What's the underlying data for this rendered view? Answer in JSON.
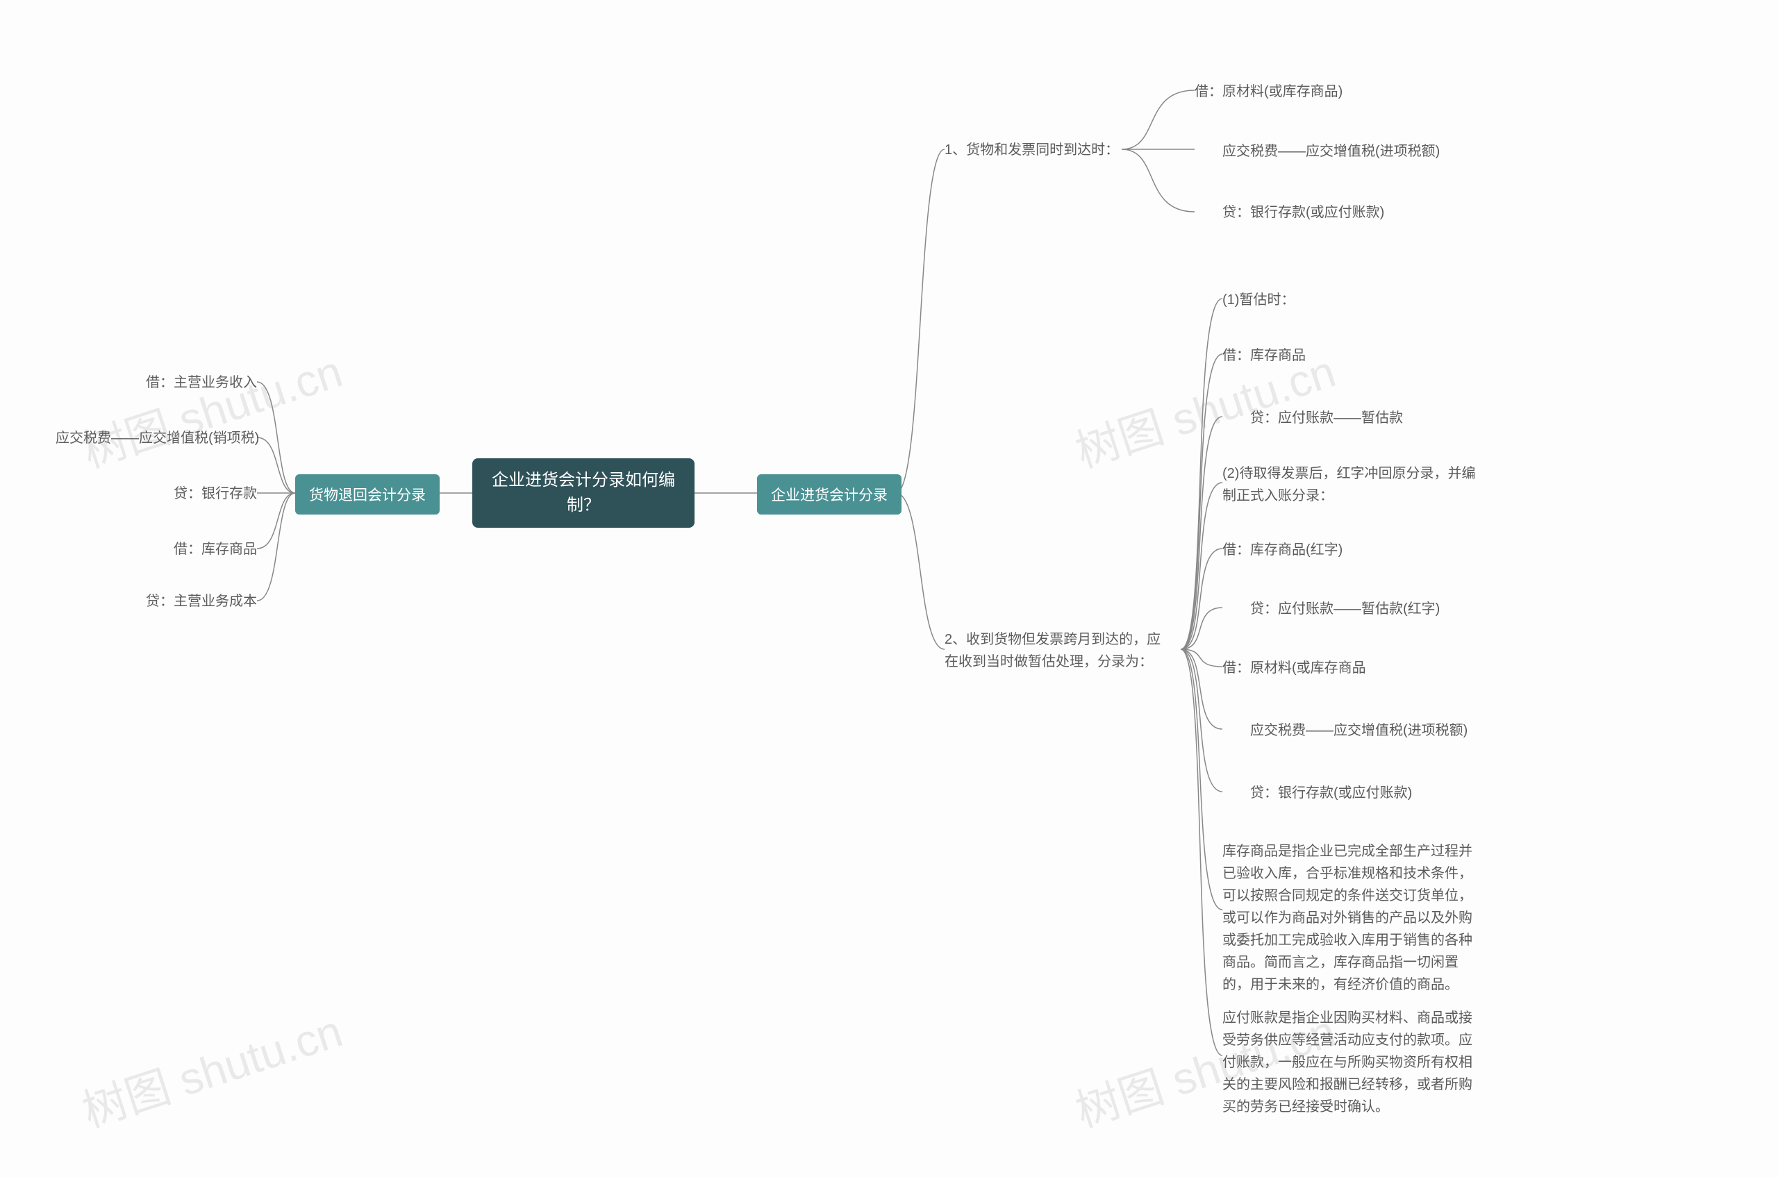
{
  "watermark_text": "树图 shutu.cn",
  "center": {
    "title": "企业进货会计分录如何编制？"
  },
  "right": {
    "branch_label": "企业进货会计分录",
    "group1": {
      "title": "1、货物和发票同时到达时：",
      "items": [
        "借：原材料(或库存商品)",
        "　　应交税费——应交增值税(进项税额)",
        "　　贷：银行存款(或应付账款)"
      ]
    },
    "group2": {
      "title": "2、收到货物但发票跨月到达的，应在收到当时做暂估处理，分录为：",
      "items": [
        "(1)暂估时：",
        "借：库存商品",
        "　　贷：应付账款——暂估款",
        "(2)待取得发票后，红字冲回原分录，并编制正式入账分录：",
        "借：库存商品(红字)",
        "　　贷：应付账款——暂估款(红字)",
        "借：原材料(或库存商品",
        "　　应交税费——应交增值税(进项税额)",
        "　　贷：银行存款(或应付账款)",
        "库存商品是指企业已完成全部生产过程并已验收入库，合乎标准规格和技术条件，可以按照合同规定的条件送交订货单位，或可以作为商品对外销售的产品以及外购或委托加工完成验收入库用于销售的各种商品。简而言之，库存商品指一切闲置的，用于未来的，有经济价值的商品。",
        "应付账款是指企业因购买材料、商品或接受劳务供应等经营活动应支付的款项。应付账款，一般应在与所购买物资所有权相关的主要风险和报酬已经转移，或者所购买的劳务已经接受时确认。"
      ]
    }
  },
  "left": {
    "branch_label": "货物退回会计分录",
    "items": [
      "借：主营业务收入",
      "应交税费——应交增值税(销项税)",
      "贷：银行存款",
      "借：库存商品",
      "贷：主营业务成本"
    ]
  }
}
